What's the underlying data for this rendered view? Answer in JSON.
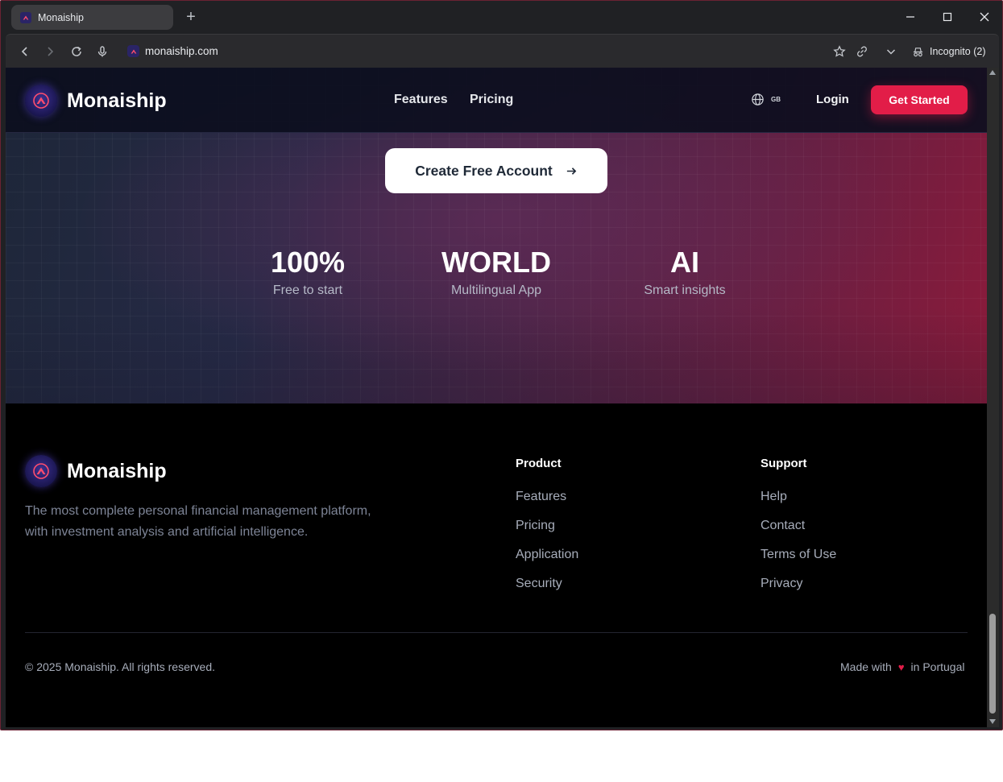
{
  "browser": {
    "tab_title": "Monaiship",
    "new_tab": "+",
    "url": "monaiship.com",
    "incognito_label": "Incognito (2)"
  },
  "navbar": {
    "brand": "Monaiship",
    "links": [
      "Features",
      "Pricing"
    ],
    "language": "GB",
    "login": "Login",
    "cta": "Get Started"
  },
  "hero": {
    "create_account": "Create Free Account",
    "stats": [
      {
        "value": "100%",
        "label": "Free to start"
      },
      {
        "value": "WORLD",
        "label": "Multilingual App"
      },
      {
        "value": "AI",
        "label": "Smart insights"
      }
    ]
  },
  "footer": {
    "brand": "Monaiship",
    "description": "The most complete personal financial management platform, with investment analysis and artificial intelligence.",
    "product": {
      "heading": "Product",
      "links": [
        "Features",
        "Pricing",
        "Application",
        "Security"
      ]
    },
    "support": {
      "heading": "Support",
      "links": [
        "Help",
        "Contact",
        "Terms of Use",
        "Privacy"
      ]
    },
    "copyright": "© 2025 Monaiship. All rights reserved.",
    "made_with_prefix": "Made with",
    "made_with_suffix": "in Portugal"
  },
  "colors": {
    "accent": "#e21d48",
    "heart": "#e21d48",
    "background": "#000000"
  },
  "icons": {
    "heart": "♥"
  }
}
